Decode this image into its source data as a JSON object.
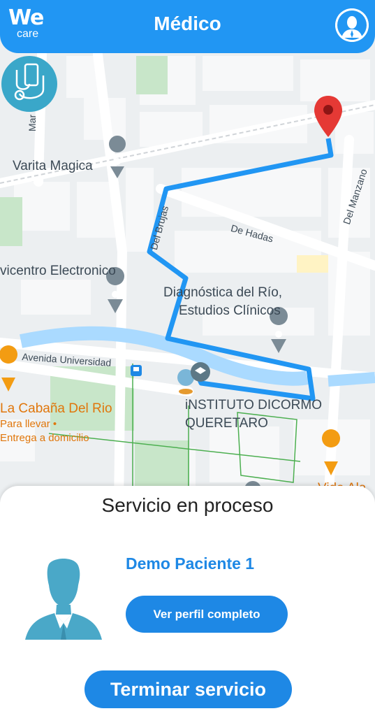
{
  "header": {
    "logo_we": "We",
    "logo_care": "care",
    "title": "Médico",
    "profile_icon": "user-avatar-icon"
  },
  "map": {
    "labels": {
      "mar_del": "Mar del",
      "varita": "Varita Magica",
      "del_brujas": "Del Brujas",
      "de_hadas": "De Hadas",
      "del_manzano": "Del Manzano",
      "electronico": "vicentro Electronico",
      "diagnostica_1": "Diagnóstica del Río,",
      "diagnostica_2": "Estudios Clínicos",
      "avenida": "Avenida Universidad",
      "instituto_1": "iNSTITUTO DICORMO",
      "instituto_2": "QUERETARO",
      "cabana": "La Cabaña Del Rio",
      "para_llevar": "Para llevar •",
      "entrega": "Entrega a domicilio",
      "edge_text": "Vida Ala"
    },
    "colors": {
      "route": "#2196f3",
      "pin": "#e53935",
      "river": "#aadaff",
      "park": "#c8e6c9"
    }
  },
  "service": {
    "status_title": "Servicio en proceso",
    "patient_name": "Demo Paciente 1",
    "profile_button": "Ver perfil completo",
    "end_button": "Terminar servicio"
  }
}
